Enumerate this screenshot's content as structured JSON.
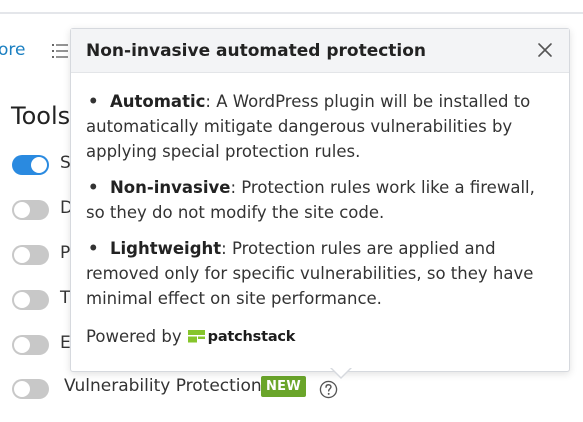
{
  "background": {
    "more_link": "ore",
    "tools_heading": "Tools",
    "tool_rows": [
      {
        "label": "S",
        "enabled": true
      },
      {
        "label": "D",
        "enabled": false
      },
      {
        "label": "P",
        "enabled": false
      },
      {
        "label": "T",
        "enabled": false
      },
      {
        "label": "E",
        "enabled": false
      }
    ],
    "vulnerability_row": {
      "label": "Vulnerability Protection",
      "badge": "NEW",
      "enabled": false,
      "help_icon": "question-circle-icon"
    }
  },
  "popover": {
    "title": "Non-invasive automated protection",
    "close_icon": "close-icon",
    "bullets": [
      {
        "term": "Automatic",
        "text": ": A WordPress plugin will be installed to automatically mitigate dangerous vulnerabilities by applying special protection rules."
      },
      {
        "term": "Non-invasive",
        "text": ": Protection rules work like a firewall, so they do not modify the site code."
      },
      {
        "term": "Lightweight",
        "text": ": Protection rules are applied and removed only for specific vulnerabilities, so they have minimal effect on site performance."
      }
    ],
    "powered_by": "Powered by",
    "brand": "patchstack",
    "brand_color": "#86c52b"
  },
  "colors": {
    "accent": "#2a8ae0",
    "link": "#1a7fc1",
    "badge_green": "#6aa52a"
  }
}
